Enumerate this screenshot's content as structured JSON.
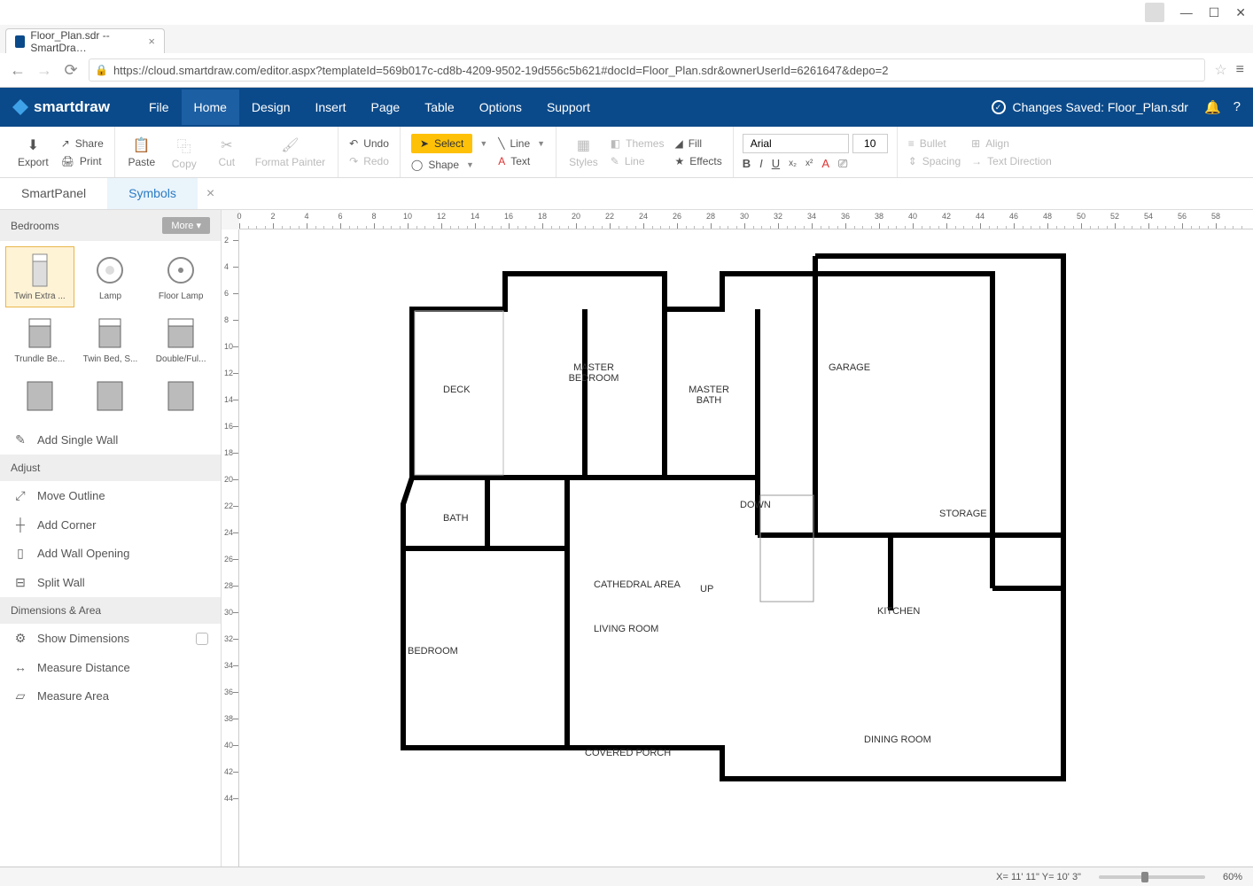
{
  "window": {
    "tab_title": "Floor_Plan.sdr -- SmartDra…",
    "url": "https://cloud.smartdraw.com/editor.aspx?templateId=569b017c-cd8b-4209-9502-19d556c5b621#docId=Floor_Plan.sdr&ownerUserId=6261647&depo=2"
  },
  "app": {
    "logo": "smartdraw",
    "menu": [
      "File",
      "Home",
      "Design",
      "Insert",
      "Page",
      "Table",
      "Options",
      "Support"
    ],
    "active_menu": "Home",
    "save_status": "Changes Saved: Floor_Plan.sdr"
  },
  "ribbon": {
    "export": "Export",
    "share": "Share",
    "print": "Print",
    "paste": "Paste",
    "copy": "Copy",
    "cut": "Cut",
    "format_painter": "Format Painter",
    "undo": "Undo",
    "redo": "Redo",
    "select": "Select",
    "shape": "Shape",
    "line": "Line",
    "text": "Text",
    "styles": "Styles",
    "themes": "Themes",
    "line2": "Line",
    "fill": "Fill",
    "effects": "Effects",
    "font_name": "Arial",
    "font_size": "10",
    "bullet": "Bullet",
    "spacing": "Spacing",
    "align": "Align",
    "text_direction": "Text Direction"
  },
  "panels": {
    "tabs": [
      "SmartPanel",
      "Symbols"
    ],
    "active_tab": "Symbols"
  },
  "sidebar": {
    "category": "Bedrooms",
    "more": "More",
    "symbols": [
      {
        "label": "Twin Extra ...",
        "selected": true
      },
      {
        "label": "Lamp"
      },
      {
        "label": "Floor Lamp"
      },
      {
        "label": "Trundle Be..."
      },
      {
        "label": "Twin Bed, S..."
      },
      {
        "label": "Double/Ful..."
      }
    ],
    "add_single_wall": "Add Single Wall",
    "adjust_header": "Adjust",
    "adjust": [
      "Move Outline",
      "Add Corner",
      "Add Wall Opening",
      "Split Wall"
    ],
    "dim_header": "Dimensions & Area",
    "show_dimensions": "Show Dimensions",
    "measure_distance": "Measure Distance",
    "measure_area": "Measure Area"
  },
  "floorplan": {
    "labels": {
      "deck": "DECK",
      "master_bedroom": "MASTER BEDROOM",
      "master_bath": "MASTER BATH",
      "garage": "GARAGE",
      "bath": "BATH",
      "down": "DOWN",
      "storage": "STORAGE",
      "cathedral": "CATHEDRAL AREA",
      "up": "UP",
      "kitchen": "KITCHEN",
      "living_room": "LIVING ROOM",
      "bedroom": "BEDROOM",
      "covered_porch": "COVERED PORCH",
      "dining_room": "DINING ROOM"
    }
  },
  "ruler": {
    "h": [
      "0",
      "2",
      "4",
      "6",
      "8",
      "10",
      "12",
      "14",
      "16",
      "18",
      "20",
      "22",
      "24",
      "26",
      "28",
      "30",
      "32",
      "34",
      "36",
      "38",
      "40",
      "42",
      "44",
      "46",
      "48",
      "50",
      "52",
      "54",
      "56",
      "58"
    ],
    "v": [
      "2",
      "4",
      "6",
      "8",
      "10",
      "12",
      "14",
      "16",
      "18",
      "20",
      "22",
      "24",
      "26",
      "28",
      "30",
      "32",
      "34",
      "36",
      "38",
      "40",
      "42",
      "44"
    ]
  },
  "status": {
    "coords": "X= 11' 11\" Y= 10' 3\"",
    "zoom": "60%"
  }
}
